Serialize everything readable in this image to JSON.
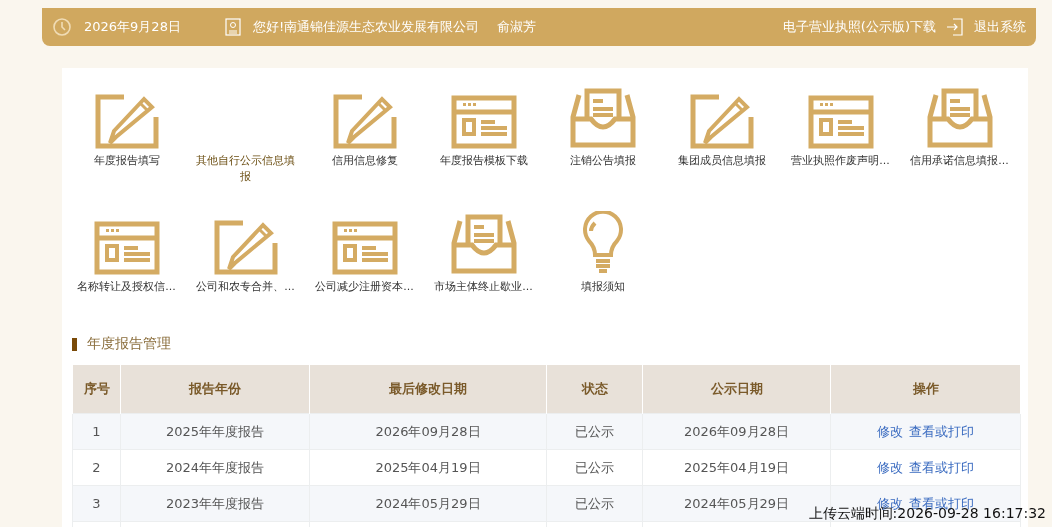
{
  "top_bar": {
    "date": "2026年9月28日",
    "greeting": "您好!南通锦佳源生态农业发展有限公司",
    "user": "俞淑芳",
    "license_link": "电子营业执照(公示版)下载",
    "logout": "退出系统"
  },
  "shortcuts": [
    {
      "label": "年度报告填写",
      "kind": "pencil"
    },
    {
      "label": "其他自行公示信息填报",
      "kind": "text"
    },
    {
      "label": "信用信息修复",
      "kind": "pencil"
    },
    {
      "label": "年度报告模板下载",
      "kind": "browser"
    },
    {
      "label": "注销公告填报",
      "kind": "tray"
    },
    {
      "label": "集团成员信息填报",
      "kind": "pencil"
    },
    {
      "label": "营业执照作废声明...",
      "kind": "browser"
    },
    {
      "label": "信用承诺信息填报...",
      "kind": "tray"
    },
    {
      "label": "名称转让及授权信...",
      "kind": "browser"
    },
    {
      "label": "公司和农专合并、...",
      "kind": "pencil"
    },
    {
      "label": "公司减少注册资本...",
      "kind": "browser"
    },
    {
      "label": "市场主体终止歇业...",
      "kind": "tray"
    },
    {
      "label": "填报须知",
      "kind": "bulb"
    }
  ],
  "section_title": "年度报告管理",
  "table": {
    "columns": [
      "序号",
      "报告年份",
      "最后修改日期",
      "状态",
      "公示日期",
      "操作"
    ],
    "rows": [
      {
        "cells": [
          "1",
          "2025年年度报告",
          "2026年09月28日",
          "已公示",
          "2026年09月28日"
        ],
        "actions": [
          "修改",
          "查看或打印"
        ]
      },
      {
        "cells": [
          "2",
          "2024年年度报告",
          "2025年04月19日",
          "已公示",
          "2025年04月19日"
        ],
        "actions": [
          "修改",
          "查看或打印"
        ]
      },
      {
        "cells": [
          "3",
          "2023年年度报告",
          "2024年05月29日",
          "已公示",
          "2024年05月29日"
        ],
        "actions": [
          "修改",
          "查看或打印"
        ]
      }
    ]
  },
  "upload_stamp": "上传云端时间:2026-09-28 16:17:32"
}
